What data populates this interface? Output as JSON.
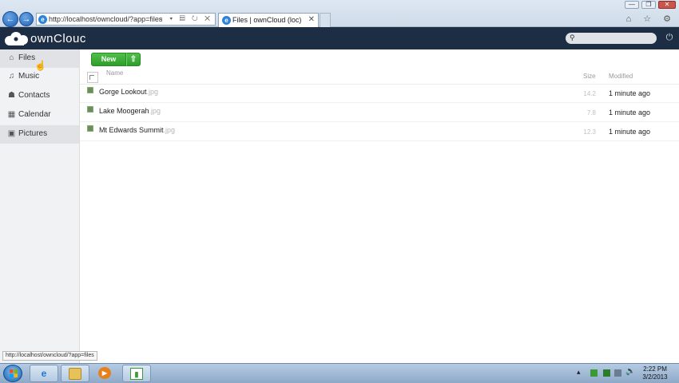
{
  "browser": {
    "back_icon": "back-arrow-icon",
    "forward_icon": "forward-arrow-icon",
    "address": "http://localhost/owncloud/?app=files",
    "address_tools": "⌕ ▾ ▤ ↻ ✕",
    "tab_title": "Files | ownCloud (loc)",
    "tab_close": "✕",
    "window_buttons": [
      "—",
      "❐",
      "✕"
    ],
    "toolbar_icons": "⌂ ☆ ⚙"
  },
  "header": {
    "logo_text": "ownClouc",
    "search_placeholder": "",
    "accent_color": "#1d2d44"
  },
  "sidebar": {
    "items": [
      {
        "label": "Files",
        "icon": "home-icon",
        "glyph": "⌂",
        "active": true
      },
      {
        "label": "Music",
        "icon": "music-icon",
        "glyph": "♫",
        "active": false
      },
      {
        "label": "Contacts",
        "icon": "contacts-icon",
        "glyph": "☗",
        "active": false
      },
      {
        "label": "Calendar",
        "icon": "calendar-icon",
        "glyph": "▦",
        "active": false
      },
      {
        "label": "Pictures",
        "icon": "pictures-icon",
        "glyph": "▣",
        "active": true
      }
    ]
  },
  "controls": {
    "new_label": "New",
    "upload_glyph": "⇧",
    "accent_color": "#35a832"
  },
  "list": {
    "columns": {
      "name": "Name",
      "size": "Size",
      "modified": "Modified"
    },
    "files": [
      {
        "name": "Gorge Lookout",
        "ext": ".jpg",
        "size": "14.2",
        "modified": "1 minute ago"
      },
      {
        "name": "Lake Moogerah",
        "ext": ".jpg",
        "size": "7.8",
        "modified": "1 minute ago"
      },
      {
        "name": "Mt Edwards Summit",
        "ext": ".jpg",
        "size": "12.3",
        "modified": "1 minute ago"
      }
    ]
  },
  "status_url": "http://localhost/owncloud/?app=files",
  "taskbar": {
    "clock_time": "2:22 PM",
    "clock_date": "3/2/2013",
    "tray_arrow": "▴"
  }
}
